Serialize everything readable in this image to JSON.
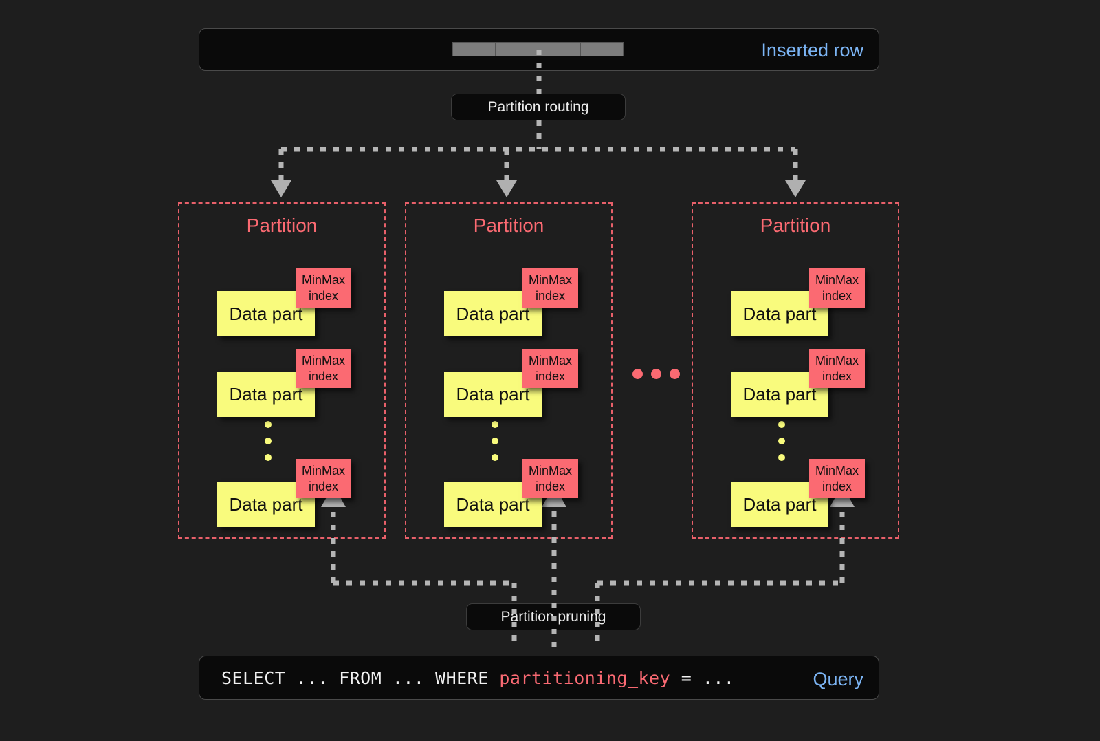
{
  "diagram": {
    "title": "ClickHouse partitioning: insert routing and partition pruning",
    "background_color": "#1e1e1e",
    "accent_colors": {
      "blue_label": "#7cb5f5",
      "partition_red": "#fb6a72",
      "data_part_yellow": "#f9fb7d",
      "connector_gray": "#b5b5b5"
    }
  },
  "inserted_row": {
    "label": "Inserted row",
    "cell_count": 4,
    "cell_color": "#7d7d7d"
  },
  "routing": {
    "label": "Partition routing"
  },
  "partitions": [
    {
      "title": "Partition",
      "parts": [
        {
          "data_part_label": "Data part",
          "index_line1": "MinMax",
          "index_line2": "index"
        },
        {
          "data_part_label": "Data part",
          "index_line1": "MinMax",
          "index_line2": "index"
        },
        {
          "data_part_label": "Data part",
          "index_line1": "MinMax",
          "index_line2": "index"
        }
      ],
      "ellipsis_dots": 3
    },
    {
      "title": "Partition",
      "parts": [
        {
          "data_part_label": "Data part",
          "index_line1": "MinMax",
          "index_line2": "index"
        },
        {
          "data_part_label": "Data part",
          "index_line1": "MinMax",
          "index_line2": "index"
        },
        {
          "data_part_label": "Data part",
          "index_line1": "MinMax",
          "index_line2": "index"
        }
      ],
      "ellipsis_dots": 3
    },
    {
      "title": "Partition",
      "parts": [
        {
          "data_part_label": "Data part",
          "index_line1": "MinMax",
          "index_line2": "index"
        },
        {
          "data_part_label": "Data part",
          "index_line1": "MinMax",
          "index_line2": "index"
        },
        {
          "data_part_label": "Data part",
          "index_line1": "MinMax",
          "index_line2": "index"
        }
      ],
      "ellipsis_dots": 3
    }
  ],
  "partitions_ellipsis_dots": 3,
  "pruning": {
    "label": "Partition pruning"
  },
  "query": {
    "label": "Query",
    "prefix": "SELECT ... FROM ... WHERE ",
    "key": "partitioning_key",
    "suffix": " = ..."
  }
}
